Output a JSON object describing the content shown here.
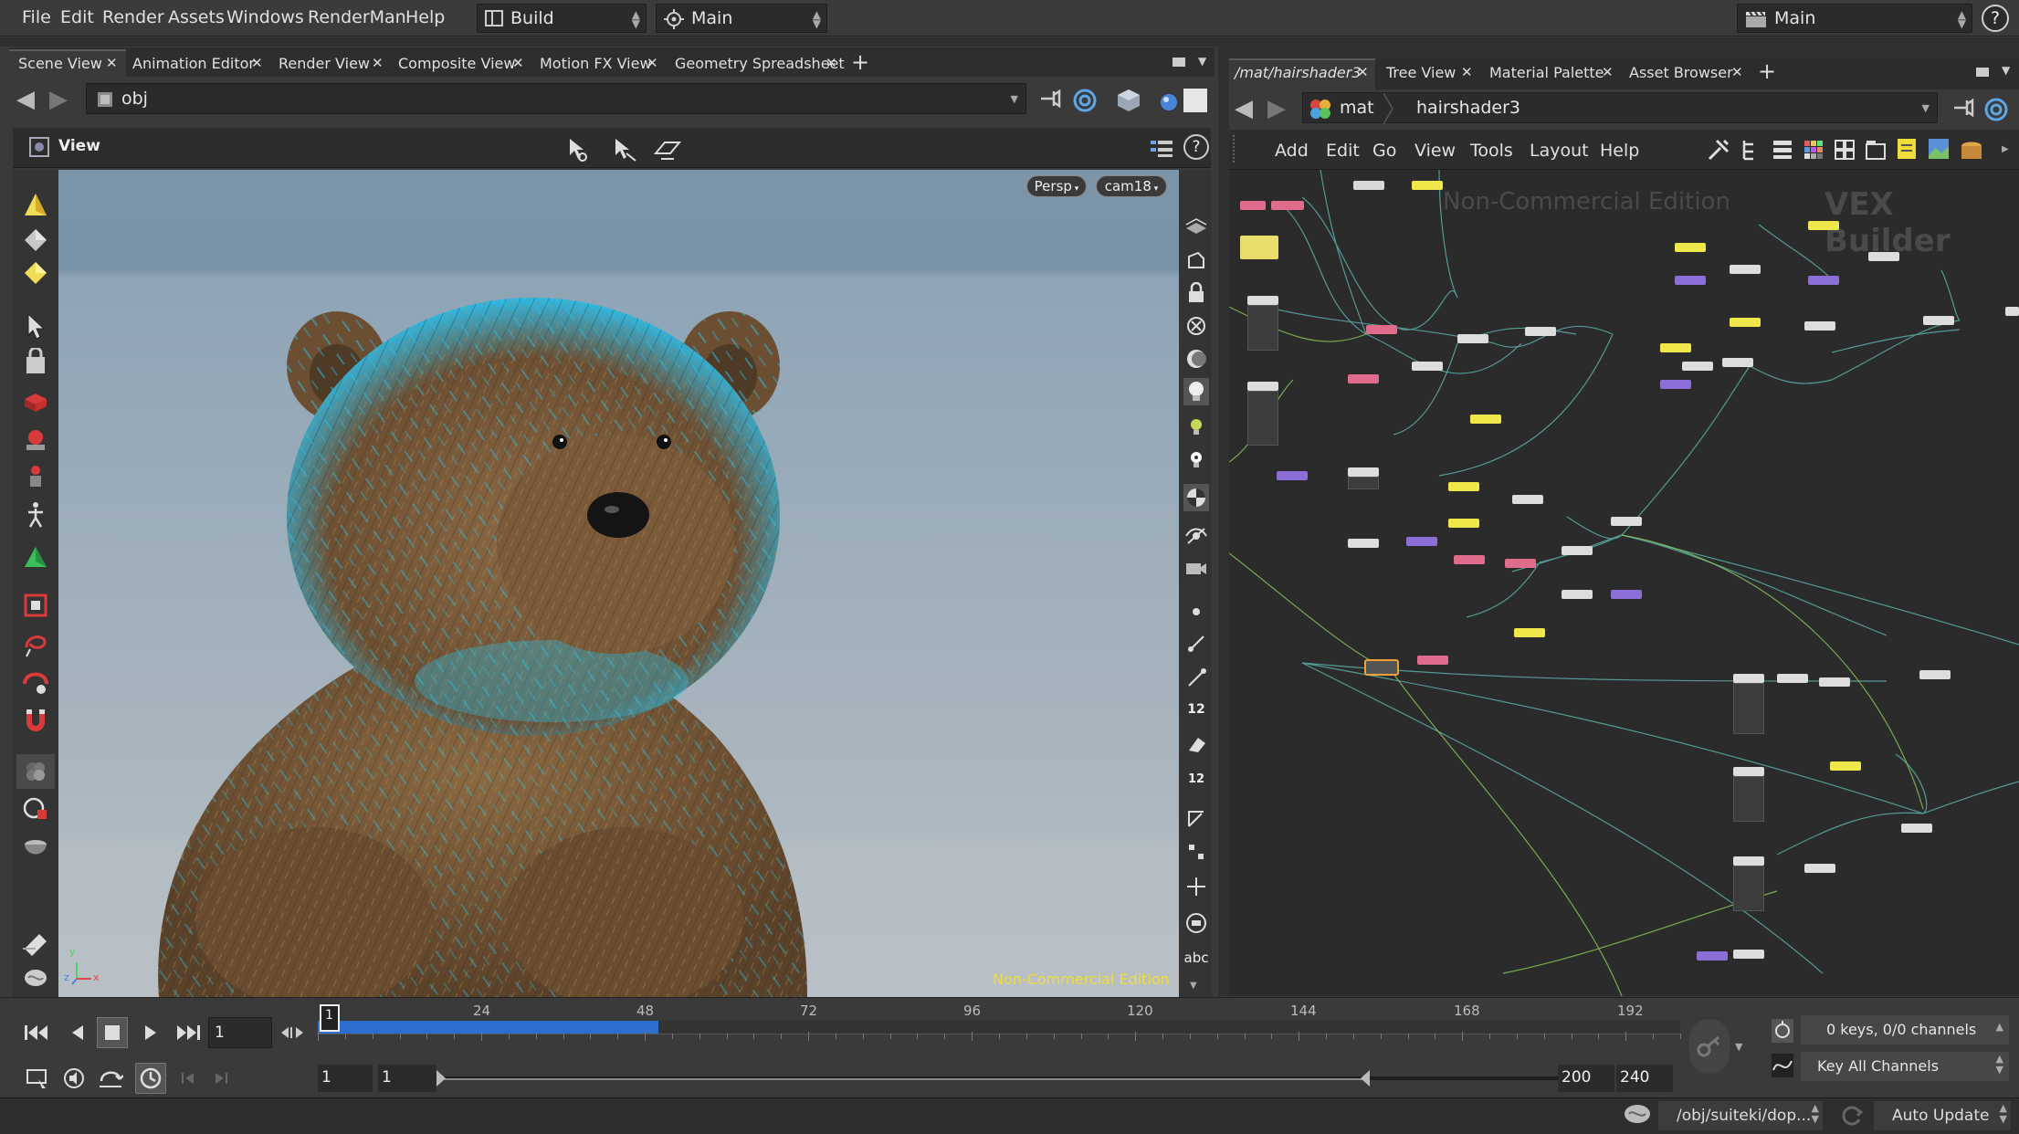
{
  "menubar": {
    "items": [
      "File",
      "Edit",
      "Render",
      "Assets",
      "Windows",
      "RenderMan",
      "Help"
    ],
    "desktop": "Build",
    "view_layout": "Main",
    "right_desktop": "Main",
    "help_glyph": "?"
  },
  "left_tabs": [
    "Scene View",
    "Animation Editor",
    "Render View",
    "Composite View",
    "Motion FX View",
    "Geometry Spreadsheet"
  ],
  "left_path": "obj",
  "viewport": {
    "header": "View",
    "persp": "Persp",
    "camera": "cam18",
    "watermark": "Non-Commercial Edition",
    "axis_x": "x",
    "axis_y": "y",
    "axis_z": "z"
  },
  "right_tabs": [
    "/mat/hairshader3",
    "Tree View",
    "Material Palette",
    "Asset Browser"
  ],
  "network": {
    "context": "mat",
    "path": "hairshader3",
    "menu": [
      "Add",
      "Edit",
      "Go",
      "View",
      "Tools",
      "Layout",
      "Help"
    ],
    "watermark": "Non-Commercial Edition",
    "builder_label": "VEX Builder"
  },
  "timeline": {
    "current_frame": "1",
    "marker": "1",
    "ticks": [
      "24",
      "48",
      "72",
      "96",
      "120",
      "144",
      "168",
      "192"
    ],
    "range_start": "1",
    "range_start2": "1",
    "range_end": "200",
    "range_end2": "240",
    "progress_fraction": 0.25
  },
  "keys": {
    "status": "0 keys, 0/0 channels",
    "key_all": "Key All Channels"
  },
  "statusbar": {
    "path": "/obj/suiteki/dop...",
    "update": "Auto Update"
  },
  "text_glyph": "abc",
  "snap_label": "12",
  "colors": {
    "accent_blue": "#2d6fcf",
    "watermark_yellow": "#f1dc3a",
    "node_pink": "#e06b8c",
    "node_yellow": "#f0e84a",
    "node_purple": "#8b6fd6",
    "fur_cyan": "#27c6f0"
  }
}
